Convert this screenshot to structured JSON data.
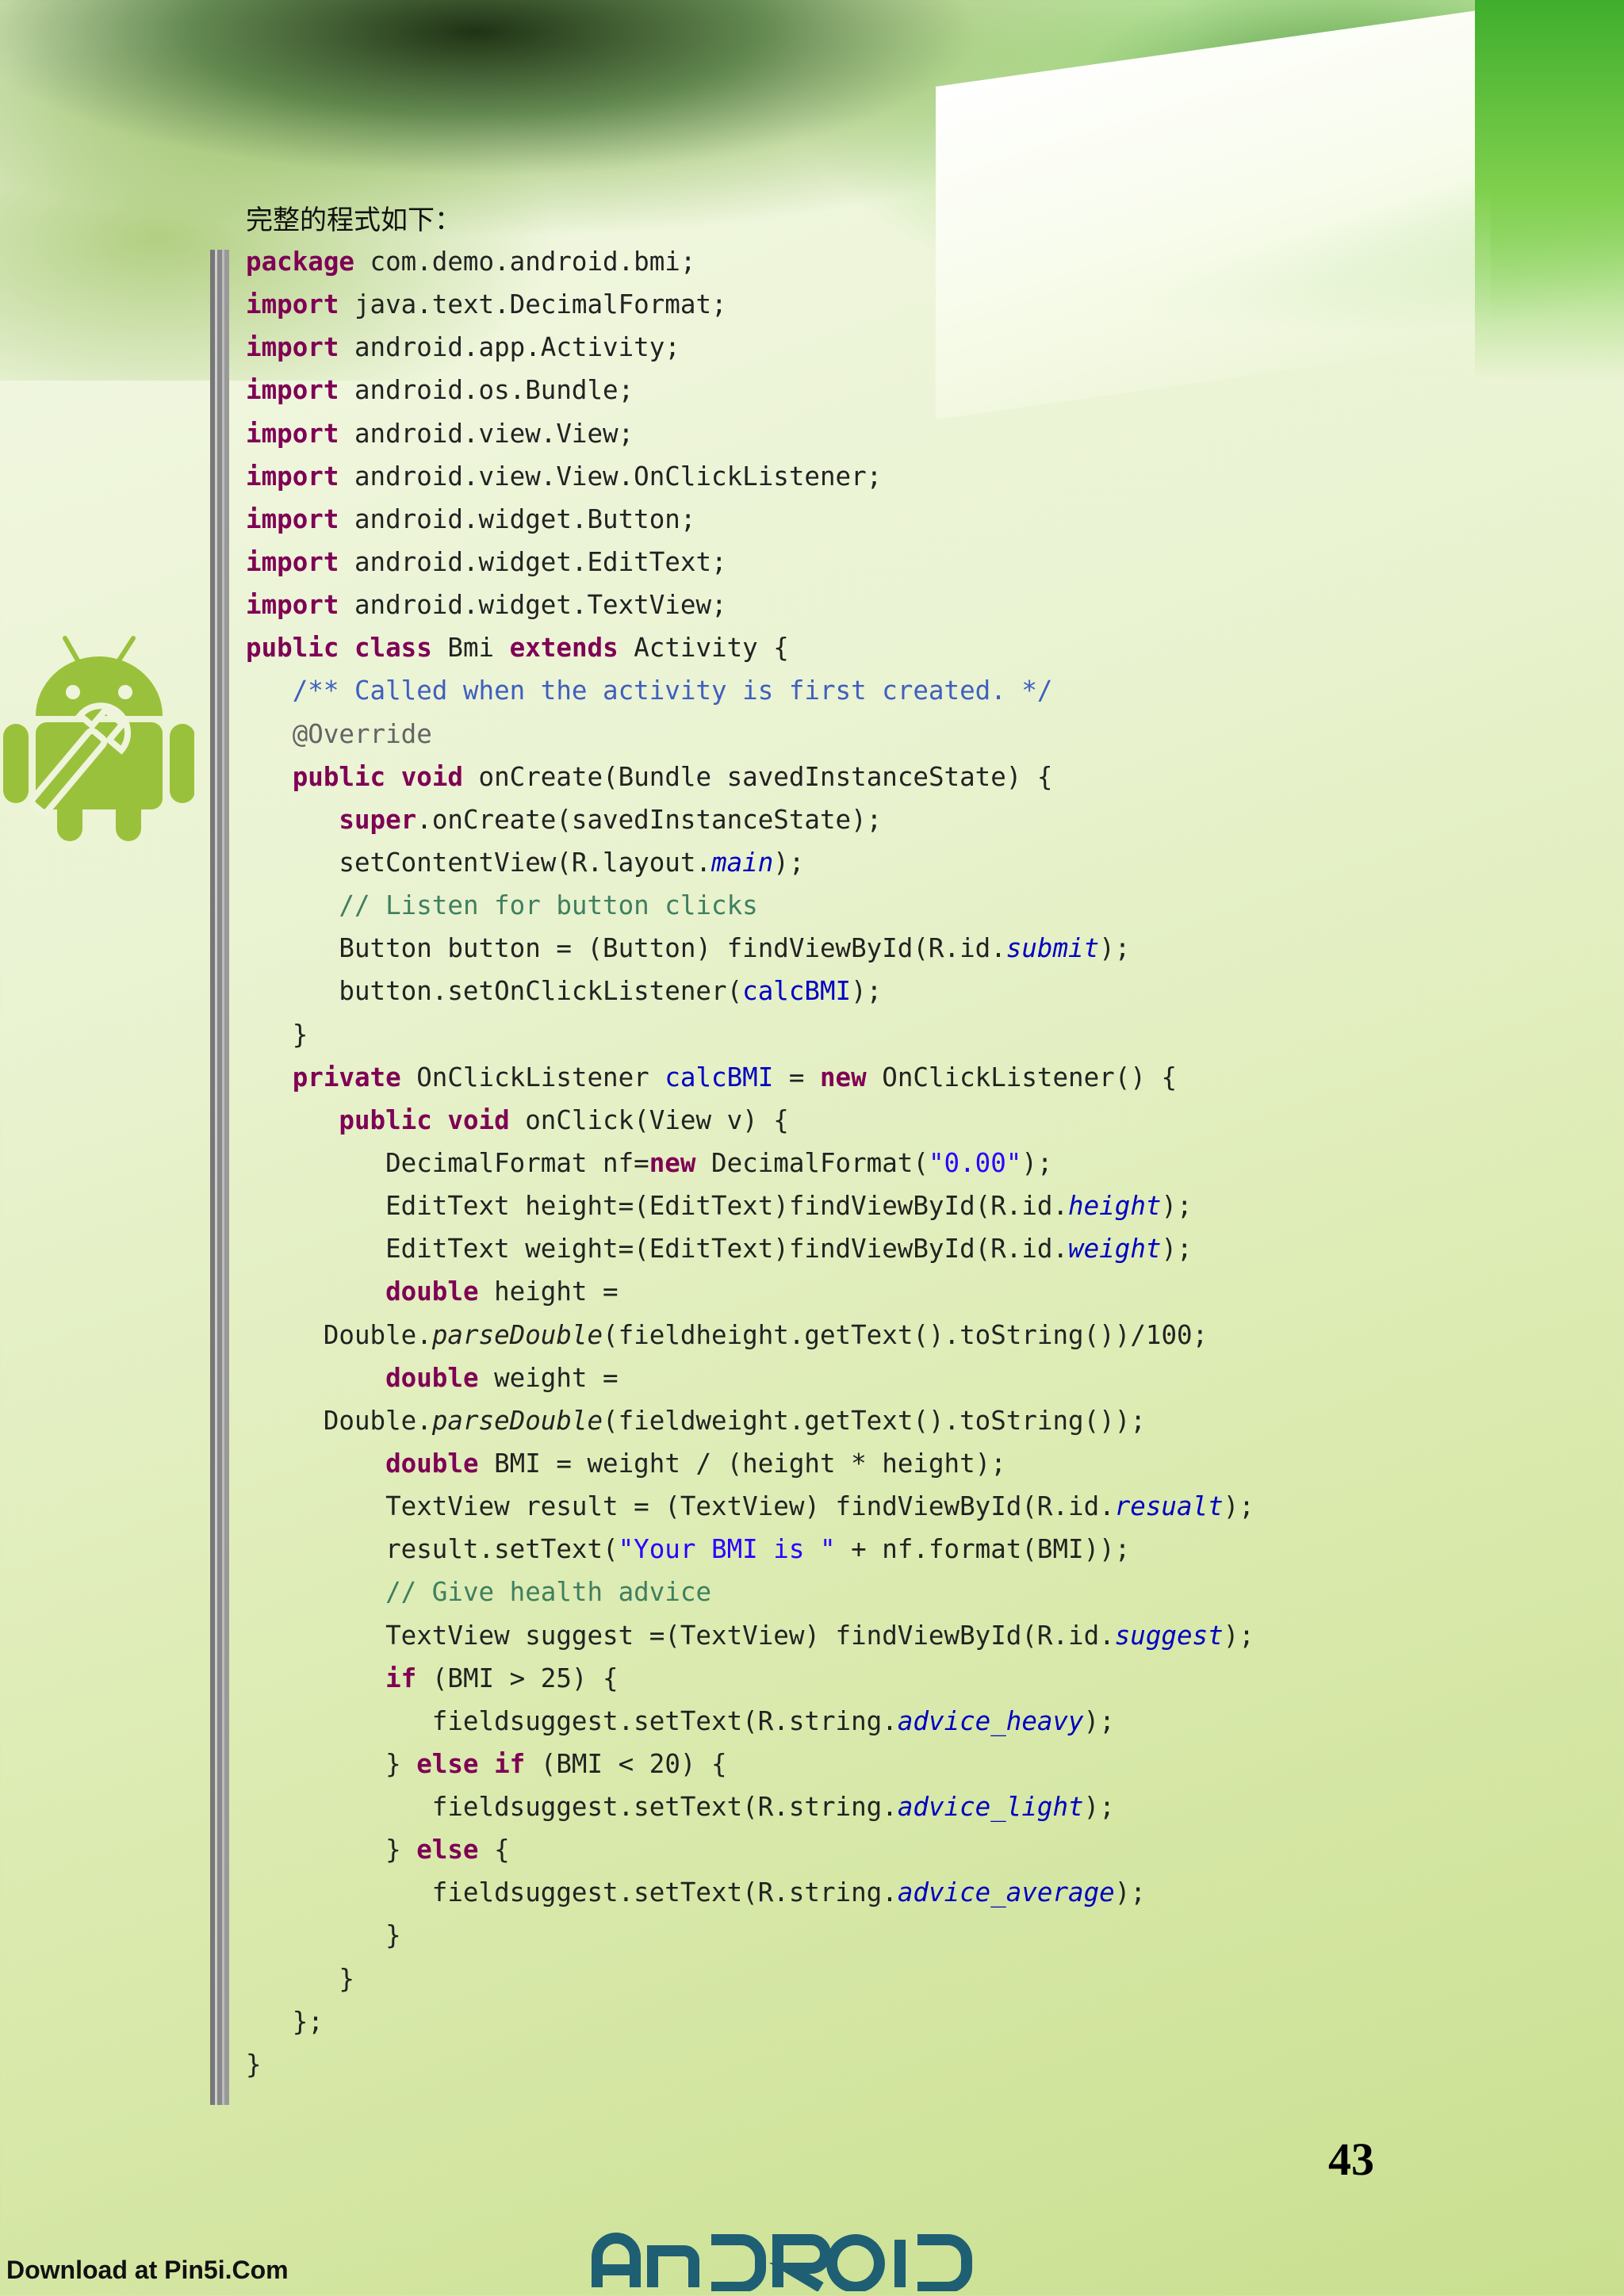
{
  "intro": "完整的程式如下：",
  "code_lines": [
    [
      {
        "t": "package",
        "c": "kw"
      },
      {
        "t": " com.demo.android.bmi;"
      }
    ],
    [
      {
        "t": "import",
        "c": "kw"
      },
      {
        "t": " java.text.DecimalFormat;"
      }
    ],
    [
      {
        "t": "import",
        "c": "kw"
      },
      {
        "t": " android.app.Activity;"
      }
    ],
    [
      {
        "t": "import",
        "c": "kw"
      },
      {
        "t": " android.os.Bundle;"
      }
    ],
    [
      {
        "t": "import",
        "c": "kw"
      },
      {
        "t": " android.view.View;"
      }
    ],
    [
      {
        "t": "import",
        "c": "kw"
      },
      {
        "t": " android.view.View.OnClickListener;"
      }
    ],
    [
      {
        "t": "import",
        "c": "kw"
      },
      {
        "t": " android.widget.Button;"
      }
    ],
    [
      {
        "t": "import",
        "c": "kw"
      },
      {
        "t": " android.widget.EditText;"
      }
    ],
    [
      {
        "t": "import",
        "c": "kw"
      },
      {
        "t": " android.widget.TextView;"
      }
    ],
    [
      {
        "t": "public",
        "c": "kw"
      },
      {
        "t": " "
      },
      {
        "t": "class",
        "c": "kw"
      },
      {
        "t": " Bmi "
      },
      {
        "t": "extends",
        "c": "kw"
      },
      {
        "t": " Activity {"
      }
    ],
    [
      {
        "t": "   "
      },
      {
        "t": "/** Called when the activity is first created. */",
        "c": "cm"
      }
    ],
    [
      {
        "t": "   "
      },
      {
        "t": "@Override",
        "c": "an"
      }
    ],
    [
      {
        "t": "   "
      },
      {
        "t": "public",
        "c": "kw"
      },
      {
        "t": " "
      },
      {
        "t": "void",
        "c": "kw"
      },
      {
        "t": " onCreate(Bundle savedInstanceState) {"
      }
    ],
    [
      {
        "t": "      "
      },
      {
        "t": "super",
        "c": "kw"
      },
      {
        "t": ".onCreate(savedInstanceState);"
      }
    ],
    [
      {
        "t": "      setContentView(R.layout."
      },
      {
        "t": "main",
        "c": "it"
      },
      {
        "t": ");"
      }
    ],
    [
      {
        "t": "      "
      },
      {
        "t": "// Listen for button clicks",
        "c": "lc"
      }
    ],
    [
      {
        "t": "      Button button = (Button) findViewById(R.id."
      },
      {
        "t": "submit",
        "c": "it"
      },
      {
        "t": ");"
      }
    ],
    [
      {
        "t": "      button.setOnClickListener("
      },
      {
        "t": "calcBMI",
        "c": "fd"
      },
      {
        "t": ");"
      }
    ],
    [
      {
        "t": "   }"
      }
    ],
    [
      {
        "t": "   "
      },
      {
        "t": "private",
        "c": "kw"
      },
      {
        "t": " OnClickListener "
      },
      {
        "t": "calcBMI",
        "c": "fd"
      },
      {
        "t": " = "
      },
      {
        "t": "new",
        "c": "kw"
      },
      {
        "t": " OnClickListener() {"
      }
    ],
    [
      {
        "t": "      "
      },
      {
        "t": "public",
        "c": "kw"
      },
      {
        "t": " "
      },
      {
        "t": "void",
        "c": "kw"
      },
      {
        "t": " onClick(View v) {"
      }
    ],
    [
      {
        "t": "         DecimalFormat nf="
      },
      {
        "t": "new",
        "c": "kw"
      },
      {
        "t": " DecimalFormat("
      },
      {
        "t": "\"0.00\"",
        "c": "st"
      },
      {
        "t": ");"
      }
    ],
    [
      {
        "t": "         EditText height=(EditText)findViewById(R.id."
      },
      {
        "t": "height",
        "c": "it"
      },
      {
        "t": ");"
      }
    ],
    [
      {
        "t": "         EditText weight=(EditText)findViewById(R.id."
      },
      {
        "t": "weight",
        "c": "it"
      },
      {
        "t": ");"
      }
    ],
    [
      {
        "t": "         "
      },
      {
        "t": "double",
        "c": "kw"
      },
      {
        "t": " height ="
      }
    ],
    [
      {
        "t": "     Double."
      },
      {
        "t": "parseDouble",
        "c": "sm"
      },
      {
        "t": "(fieldheight.getText().toString())/100;"
      }
    ],
    [
      {
        "t": "         "
      },
      {
        "t": "double",
        "c": "kw"
      },
      {
        "t": " weight ="
      }
    ],
    [
      {
        "t": "     Double."
      },
      {
        "t": "parseDouble",
        "c": "sm"
      },
      {
        "t": "(fieldweight.getText().toString());"
      }
    ],
    [
      {
        "t": "         "
      },
      {
        "t": "double",
        "c": "kw"
      },
      {
        "t": " BMI = weight / (height * height);"
      }
    ],
    [
      {
        "t": "         TextView result = (TextView) findViewById(R.id."
      },
      {
        "t": "resualt",
        "c": "it"
      },
      {
        "t": ");"
      }
    ],
    [
      {
        "t": "         result.setText("
      },
      {
        "t": "\"Your BMI is \"",
        "c": "st"
      },
      {
        "t": " + nf.format(BMI));"
      }
    ],
    [
      {
        "t": "         "
      },
      {
        "t": "// Give health advice",
        "c": "lc"
      }
    ],
    [
      {
        "t": "         TextView suggest =(TextView) findViewById(R.id."
      },
      {
        "t": "suggest",
        "c": "it"
      },
      {
        "t": ");"
      }
    ],
    [
      {
        "t": "         "
      },
      {
        "t": "if",
        "c": "kw"
      },
      {
        "t": " (BMI > 25) {"
      }
    ],
    [
      {
        "t": "            fieldsuggest.setText(R.string."
      },
      {
        "t": "advice_heavy",
        "c": "it"
      },
      {
        "t": ");"
      }
    ],
    [
      {
        "t": "         } "
      },
      {
        "t": "else",
        "c": "kw"
      },
      {
        "t": " "
      },
      {
        "t": "if",
        "c": "kw"
      },
      {
        "t": " (BMI < 20) {"
      }
    ],
    [
      {
        "t": "            fieldsuggest.setText(R.string."
      },
      {
        "t": "advice_light",
        "c": "it"
      },
      {
        "t": ");"
      }
    ],
    [
      {
        "t": "         } "
      },
      {
        "t": "else",
        "c": "kw"
      },
      {
        "t": " {"
      }
    ],
    [
      {
        "t": "            fieldsuggest.setText(R.string."
      },
      {
        "t": "advice_average",
        "c": "it"
      },
      {
        "t": ");"
      }
    ],
    [
      {
        "t": "         }"
      }
    ],
    [
      {
        "t": "      }"
      }
    ],
    [
      {
        "t": "   };"
      }
    ],
    [
      {
        "t": "}"
      }
    ]
  ],
  "page_number": "43",
  "footer": {
    "download_text": "Download at Pin5i.Com",
    "logo_text": "android"
  },
  "colors": {
    "keyword": "#7f0055",
    "comment": "#3f5fbf",
    "line_comment": "#3f7f5f",
    "annotation": "#646464",
    "field": "#0000c0",
    "string": "#2a00ff",
    "logo": "#1f5f73",
    "robot": "#9ac13b"
  },
  "icons": {
    "robot": "android-robot-wrench-icon",
    "logo": "android-wordmark-logo"
  }
}
